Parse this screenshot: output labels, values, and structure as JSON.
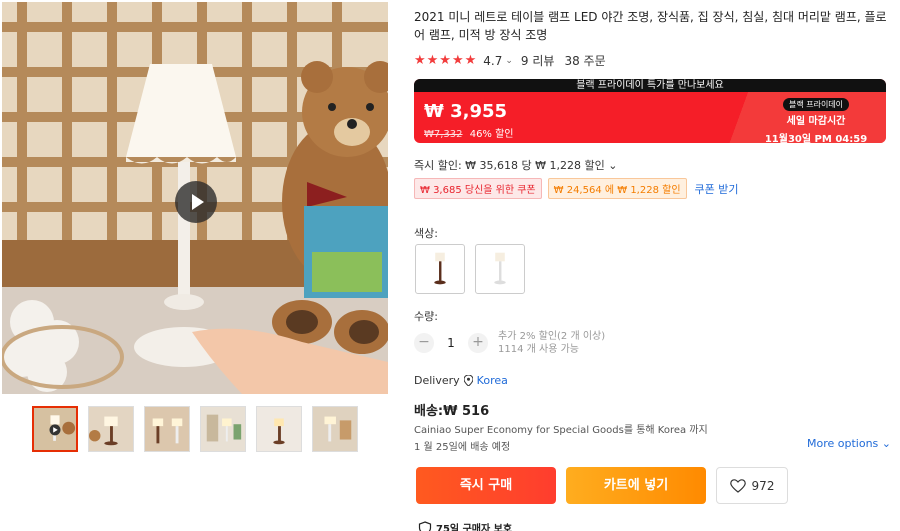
{
  "product": {
    "title": "2021 미니 레트로 테이블 램프 LED 야간 조명, 장식품, 집 장식, 침실, 침대 머리맡 램프, 플로어 램프, 미적 방 장식 조명"
  },
  "rating": {
    "stars": "★★★★★",
    "score": "4.7",
    "reviews": "9 리뷰",
    "orders": "38 주문"
  },
  "deal": {
    "banner": "블랙 프라이데이 특가를 만나보세요",
    "price": "₩ 3,955",
    "original_price": "₩7,332",
    "discount": "46% 할인",
    "badge": "블랙 프라이데이",
    "ends_label": "세일 마감시간",
    "ends_at": "11월30일 PM 04:59 KST"
  },
  "instant_discount": "즉시 할인: ₩ 35,618 당 ₩ 1,228 할인",
  "coupons": [
    {
      "label": "₩ 3,685 당신을 위한 쿠폰"
    },
    {
      "label": "₩ 24,564 에 ₩ 1,228 할인"
    }
  ],
  "coupon_link": "쿠폰 받기",
  "color": {
    "label": "색상:",
    "options": [
      "black-base lamp",
      "white lamp"
    ]
  },
  "quantity": {
    "label": "수량:",
    "value": "1",
    "minus": "−",
    "plus": "+",
    "note_line1": "추가 2% 할인(2 개 이상)",
    "note_line2": "1114 개 사용 가능"
  },
  "delivery": {
    "label": "Delivery",
    "location": "Korea"
  },
  "shipping": {
    "label": "배송:₩ 516",
    "method": "Cainiao Super Economy for Special Goods를 통해 Korea 까지",
    "eta": "1 월 25일에 배송 예정",
    "more": "More options"
  },
  "actions": {
    "buy": "즉시 구매",
    "cart": "카트에 넣기",
    "wish_count": "972"
  },
  "buyer_protection": "75일 구매자 보호",
  "colors": {
    "accent_red": "#f51e28",
    "buy_orange": "#ff5a1f",
    "cart_orange": "#ff8a00",
    "link_blue": "#1f6ad8"
  }
}
